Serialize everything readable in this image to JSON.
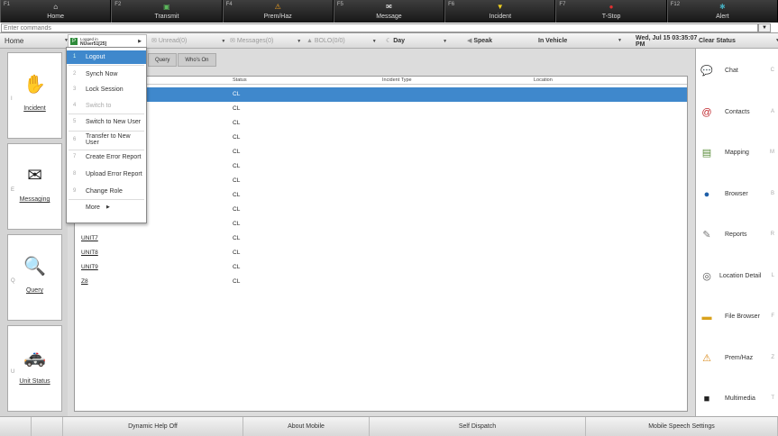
{
  "fkeys": [
    {
      "fn": "F1",
      "icon": "home-icon",
      "glyph": "⌂",
      "label": "Home"
    },
    {
      "fn": "F2",
      "icon": "transmit-icon",
      "glyph": "▣",
      "label": "Transmit"
    },
    {
      "fn": "F4",
      "icon": "prem-haz-icon",
      "glyph": "⚠",
      "label": "Prem/Haz"
    },
    {
      "fn": "F5",
      "icon": "message-icon",
      "glyph": "✉",
      "label": "Message"
    },
    {
      "fn": "F6",
      "icon": "incident-icon",
      "glyph": "▼",
      "label": "Incident"
    },
    {
      "fn": "F7",
      "icon": "t-stop-icon",
      "glyph": "●",
      "label": "T-Stop"
    },
    {
      "fn": "F12",
      "icon": "alert-icon",
      "glyph": "✱",
      "label": "Alert"
    }
  ],
  "command": {
    "placeholder": "Enter commands",
    "value": ""
  },
  "status": {
    "home": "Home",
    "logged_in": "Logged in",
    "user": "NUser51[25]",
    "unread": "Unread(0)",
    "messages": "Messages(0)",
    "bolo": "BOLO(0/0)",
    "day": "Day",
    "speak": "Speak",
    "vehicle": "In Vehicle",
    "datetime": "Wed, Jul 15 03:35:07",
    "datetime2": "PM",
    "clear": "Clear Status"
  },
  "left_tiles": [
    {
      "key": "I",
      "label": "Incident",
      "icon": "incident-tile-icon",
      "glyph": "✋"
    },
    {
      "key": "E",
      "label": "Messaging",
      "icon": "messaging-icon",
      "glyph": "✉"
    },
    {
      "key": "Q",
      "label": "Query",
      "icon": "query-icon",
      "glyph": "🔍"
    },
    {
      "key": "U",
      "label": "Unit Status",
      "icon": "unit-status-icon",
      "glyph": "🚓"
    }
  ],
  "tabs": [
    "Query",
    "Who's On"
  ],
  "grid": {
    "headers": [
      "Status",
      "Incident Type",
      "Location"
    ],
    "rows": [
      {
        "unit": "",
        "status": "CL",
        "selected": true
      },
      {
        "unit": "",
        "status": "CL"
      },
      {
        "unit": "",
        "status": "CL"
      },
      {
        "unit": "",
        "status": "CL"
      },
      {
        "unit": "",
        "status": "CL"
      },
      {
        "unit": "",
        "status": "CL"
      },
      {
        "unit": "",
        "status": "CL"
      },
      {
        "unit": "",
        "status": "CL"
      },
      {
        "unit": "",
        "status": "CL"
      },
      {
        "unit": "",
        "status": "CL"
      },
      {
        "unit": "UNIT7",
        "status": "CL"
      },
      {
        "unit": "UNIT8",
        "status": "CL"
      },
      {
        "unit": "UNIT9",
        "status": "CL"
      },
      {
        "unit": "Z8",
        "status": "CL"
      }
    ]
  },
  "menu": [
    {
      "n": "1",
      "label": "Logout",
      "selected": true
    },
    {
      "n": "2",
      "label": "Synch Now"
    },
    {
      "n": "3",
      "label": "Lock Session"
    },
    {
      "n": "4",
      "label": "Switch to",
      "disabled": true
    },
    {
      "n": "5",
      "label": "Switch to New User"
    },
    {
      "n": "6",
      "label": "Transfer to New User"
    },
    {
      "n": "7",
      "label": "Create Error Report"
    },
    {
      "n": "8",
      "label": "Upload Error Report"
    },
    {
      "n": "9",
      "label": "Change Role"
    },
    {
      "n": "",
      "label": "More"
    }
  ],
  "right_items": [
    {
      "label": "Chat",
      "key": "C",
      "icon": "chat-icon",
      "glyph": "💬",
      "color": "#2a6fb8"
    },
    {
      "label": "Contacts",
      "key": "A",
      "icon": "contacts-icon",
      "glyph": "@",
      "color": "#c0272d"
    },
    {
      "label": "Mapping",
      "key": "M",
      "icon": "mapping-icon",
      "glyph": "▤",
      "color": "#5a8c3a"
    },
    {
      "label": "Browser",
      "key": "B",
      "icon": "browser-icon",
      "glyph": "●",
      "color": "#1f5fa8"
    },
    {
      "label": "Reports",
      "key": "R",
      "icon": "reports-icon",
      "glyph": "✎",
      "color": "#777"
    },
    {
      "label": "Location Detail",
      "key": "L",
      "icon": "location-detail-icon",
      "glyph": "◎",
      "color": "#555"
    },
    {
      "label": "File Browser",
      "key": "F",
      "icon": "file-browser-icon",
      "glyph": "▬",
      "color": "#d9a21b"
    },
    {
      "label": "Prem/Haz",
      "key": "Z",
      "icon": "prem-haz-right-icon",
      "glyph": "⚠",
      "color": "#d98a1b"
    },
    {
      "label": "Multimedia",
      "key": "T",
      "icon": "multimedia-icon",
      "glyph": "■",
      "color": "#222"
    }
  ],
  "bottom": [
    "Dynamic Help Off",
    "About Mobile",
    "Self Dispatch",
    "Mobile Speech Settings"
  ],
  "colors": {
    "selection": "#3f88cc"
  }
}
